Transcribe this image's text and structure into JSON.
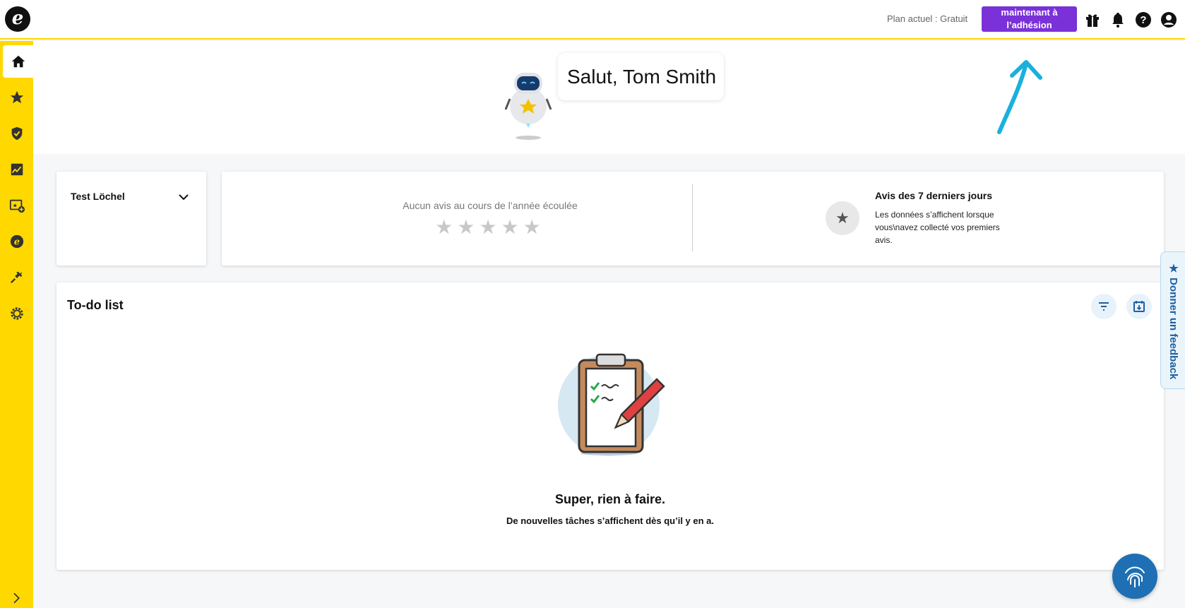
{
  "header": {
    "logo_letter": "e",
    "plan_text": "Plan actuel : Gratuit",
    "upgrade_label_line1": "maintenant à",
    "upgrade_label_line2": "l’adhésion"
  },
  "greeting": "Salut, Tom Smith",
  "location": {
    "name": "Test Löchel"
  },
  "reviews": {
    "no_reviews_text": "Aucun avis au cours de l’année écoulée",
    "stars": "★★★★★",
    "last7_title": "Avis des 7 derniers jours",
    "last7_desc": "Les données s’affichent lorsque vous\\navez collecté vos premiers avis."
  },
  "todo": {
    "title": "To-do list",
    "empty_title": "Super, rien à faire.",
    "empty_sub": "De nouvelles tâches s’affichent dès qu’il y en a."
  },
  "feedback": {
    "label": "★ Donner un feedback"
  },
  "colors": {
    "sidebar": "#ffd800",
    "accent_purple": "#7a31d8",
    "fab_blue": "#1e6fb3",
    "arrow": "#1ab0dd"
  }
}
